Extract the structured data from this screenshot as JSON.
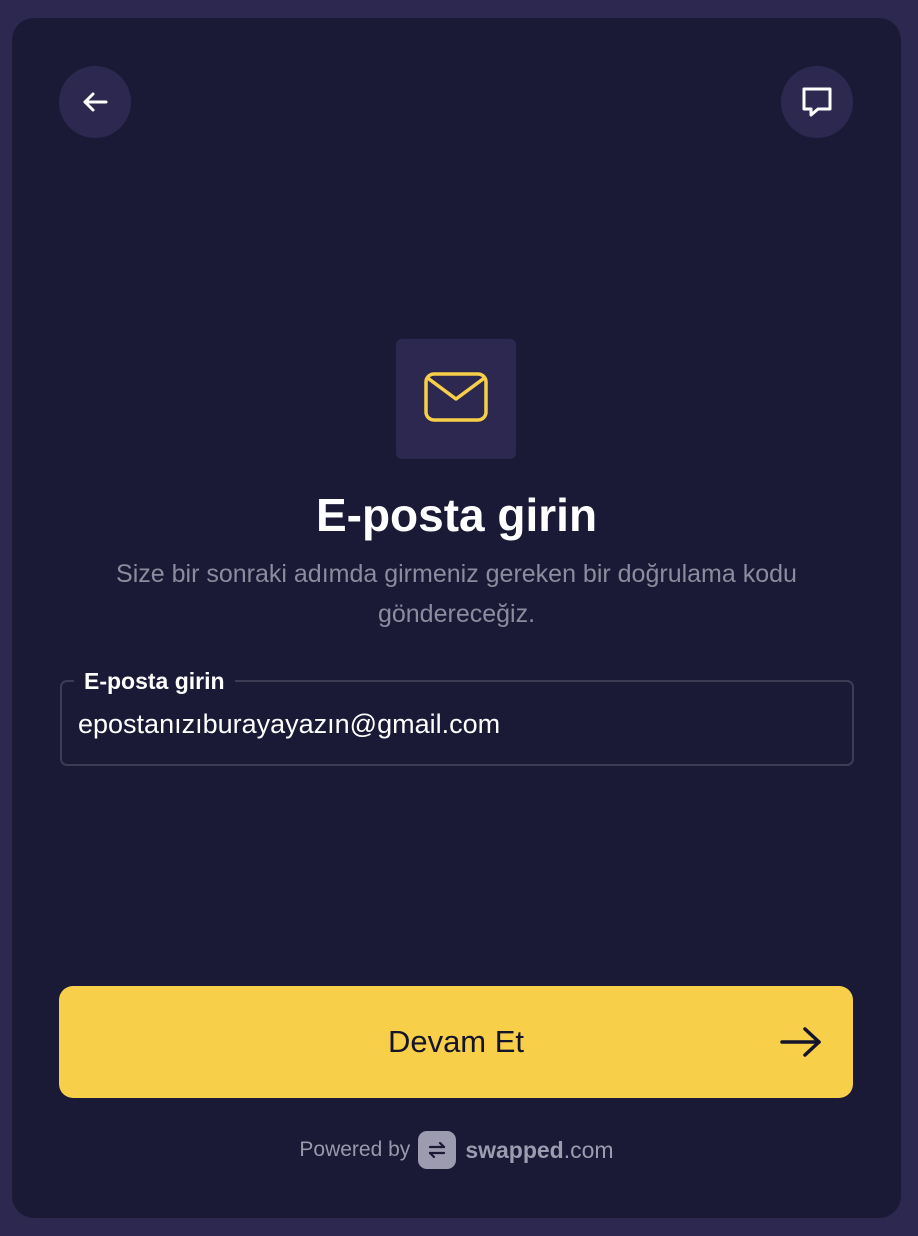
{
  "header": {
    "back_icon": "arrow-left-icon",
    "chat_icon": "chat-bubble-icon"
  },
  "hero": {
    "icon": "envelope-icon",
    "icon_color": "#f7cf48",
    "title": "E-posta girin",
    "subtitle": "Size bir sonraki adımda girmeniz gereken bir doğrulama kodu göndereceğiz."
  },
  "email_field": {
    "label": "E-posta girin",
    "value": "epostanızıburayayazın@gmail.com"
  },
  "continue_button": {
    "label": "Devam Et",
    "icon": "arrow-right-icon",
    "color": "#f7cf48"
  },
  "footer": {
    "powered_by": "Powered by",
    "brand_bold": "swapped",
    "brand_light": ".com",
    "logo_icon": "swap-arrows-icon"
  }
}
